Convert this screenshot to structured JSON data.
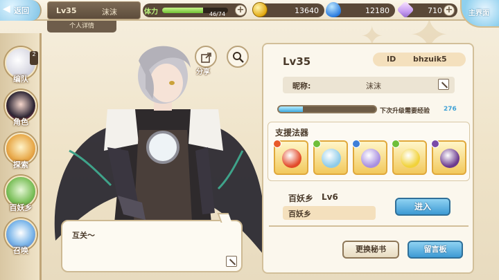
{
  "topbar": {
    "back_label": "返回",
    "player_level": "Lv35",
    "player_name": "沫沫",
    "detail_tab": "个人详情",
    "stamina_label": "体力",
    "stamina_value": "46/74",
    "stamina_fraction": 0.62,
    "coins": "13640",
    "gems": "12180",
    "crystals": "710",
    "main_label": "主界面"
  },
  "sidebar": {
    "items": [
      {
        "label": "编队",
        "badge": "2"
      },
      {
        "label": "角色"
      },
      {
        "label": "探索"
      },
      {
        "label": "百妖乡"
      },
      {
        "label": "召唤"
      }
    ]
  },
  "character": {
    "share_label": "分享",
    "speech": "互关～"
  },
  "profile": {
    "level": "Lv35",
    "id_label": "ID",
    "id_value": "bhzuik5",
    "nick_label": "昵称:",
    "nick_value": "沫沫",
    "exp_label": "下次升级需要经验",
    "exp_value": "276",
    "exp_fraction": 0.25,
    "support_title": "支援法器",
    "support_slots": [
      {
        "name": "red-bag-artifact",
        "element": "fire",
        "color": "#e24a2a"
      },
      {
        "name": "crystal-shard-artifact",
        "element": "wind",
        "color": "#8ecbe8"
      },
      {
        "name": "spiral-feather-artifact",
        "element": "water",
        "color": "#a88fe0"
      },
      {
        "name": "golden-wand-artifact",
        "element": "wind",
        "color": "#f1d23a"
      },
      {
        "name": "dark-pot-artifact",
        "element": "dark",
        "color": "#6b3a8e"
      }
    ],
    "guild_name": "百妖乡",
    "guild_level": "Lv6",
    "guild_bar_text": "百妖乡",
    "enter_button": "进入",
    "secretary_button": "更换秘书",
    "board_button": "留言板"
  },
  "colors": {
    "accent_blue": "#3d9ad4",
    "panel_border": "#d2bf99",
    "exp_text": "#3fa1d5"
  }
}
